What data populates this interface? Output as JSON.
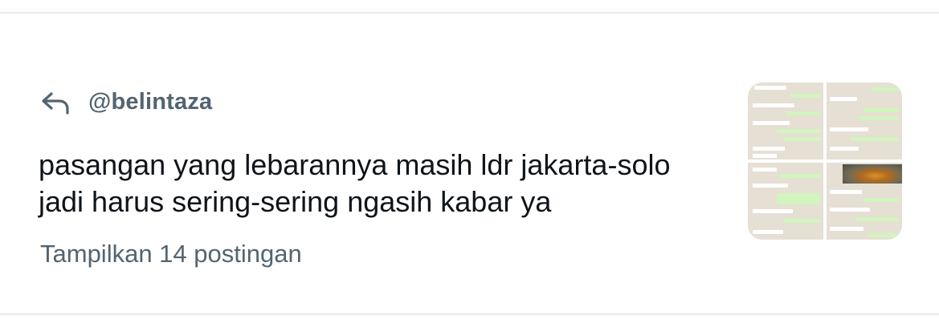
{
  "reply": {
    "icon": "reply-arrow-icon",
    "handle": "@belintaza"
  },
  "tweet": {
    "text": "pasangan yang lebarannya masih ldr jakarta-solo jadi harus sering-sering ngasih kabar ya",
    "show_more": "Tampilkan 14 postingan"
  },
  "thumbnail": {
    "description_icon": "chat-screenshots-grid",
    "colors": {
      "background": "#e6dfd3",
      "incoming_bubble": "#ffffff",
      "outgoing_bubble": "#d2f4be"
    }
  },
  "colors": {
    "text_primary": "#0f1419",
    "text_secondary": "#536471",
    "divider": "#e7e9eb"
  }
}
